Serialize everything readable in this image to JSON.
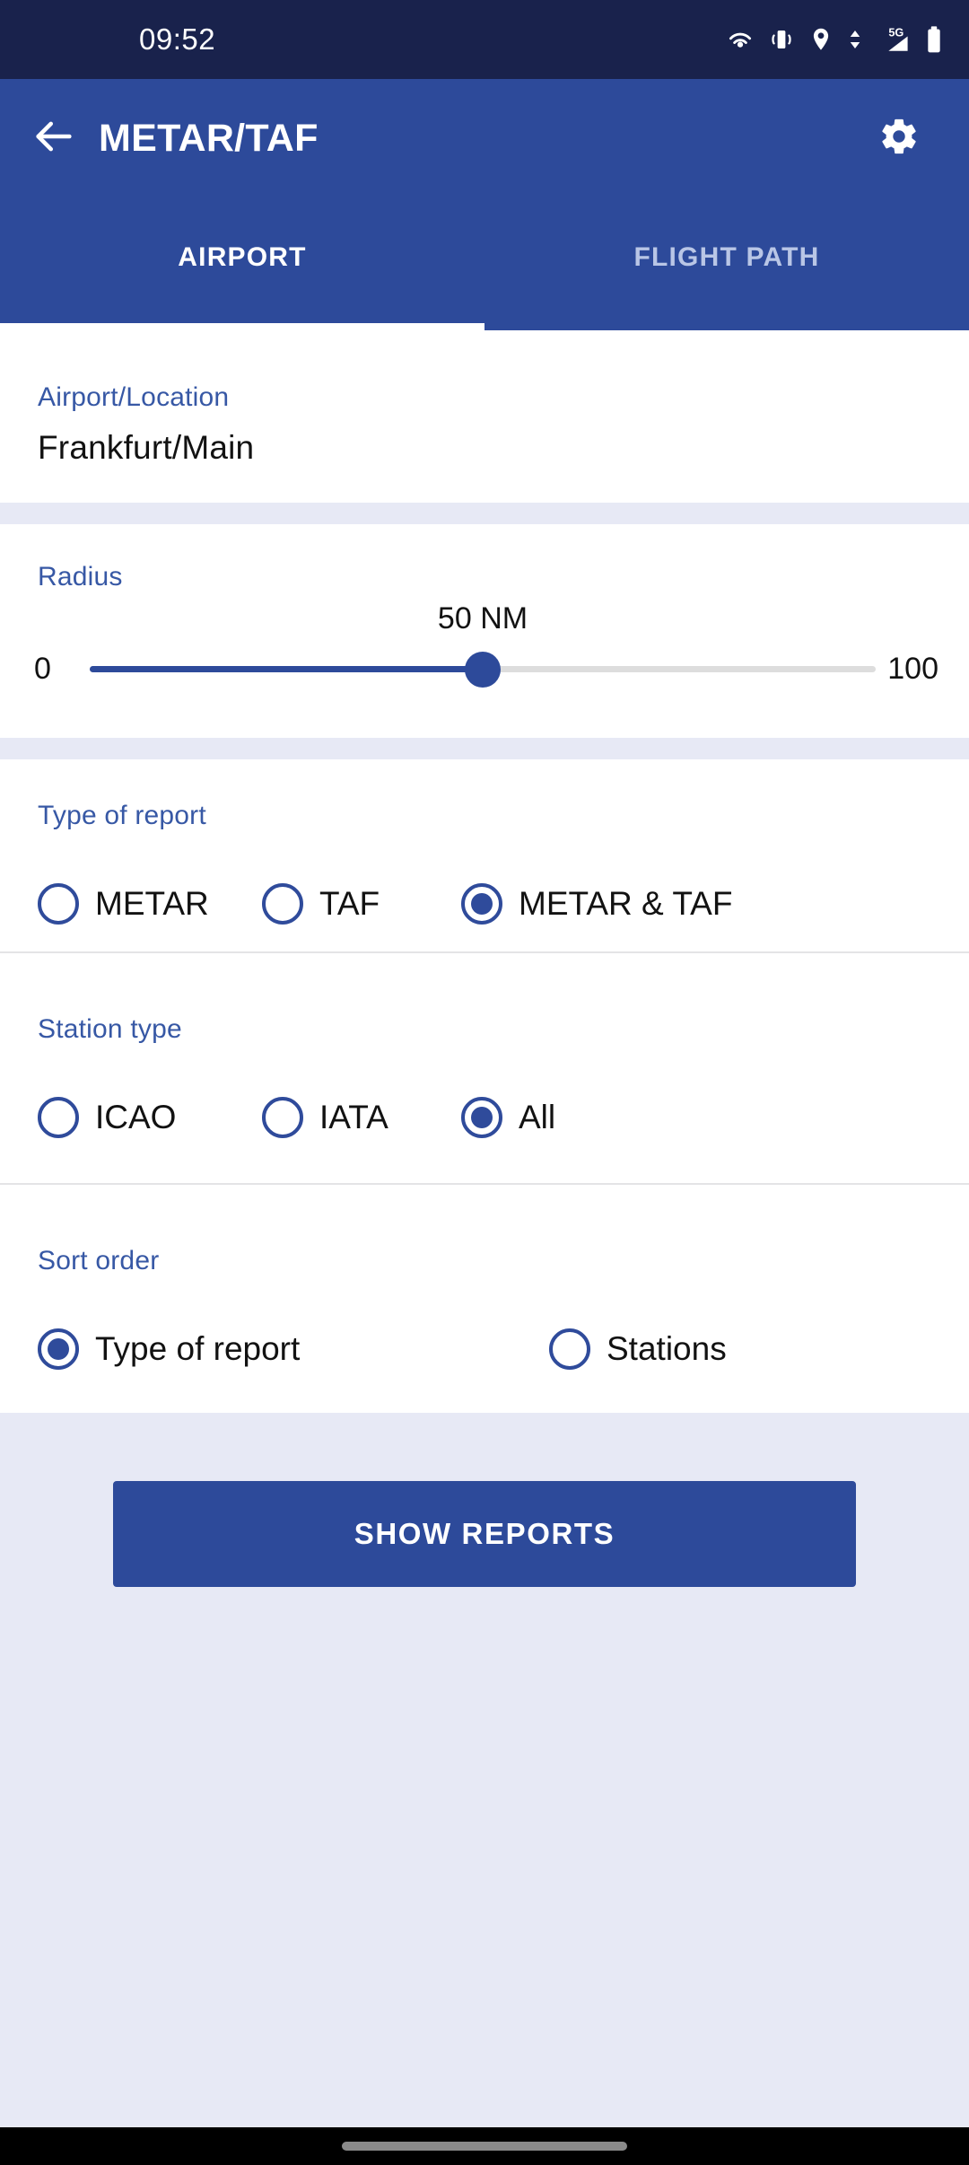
{
  "status_bar": {
    "time": "09:52",
    "network_label": "5G",
    "icons": [
      "cast-icon",
      "vibrate-icon",
      "location-icon",
      "data-transfer-icon",
      "signal-icon",
      "battery-icon"
    ],
    "background_color": "#19224C"
  },
  "app_bar": {
    "title": "METAR/TAF",
    "back_icon": "arrow-left-icon",
    "settings_icon": "gear-icon",
    "background_color": "#2D4A9A",
    "tabs": [
      {
        "label": "AIRPORT",
        "active": true
      },
      {
        "label": "FLIGHT PATH",
        "active": false
      }
    ]
  },
  "airport": {
    "label": "Airport/Location",
    "value": "Frankfurt/Main"
  },
  "radius": {
    "label": "Radius",
    "value_text": "50 NM",
    "value": 50,
    "min_label": "0",
    "max_label": "100",
    "min": 0,
    "max": 100,
    "accent_color": "#2D4A9A"
  },
  "type_of_report": {
    "label": "Type of report",
    "options": [
      {
        "label": "METAR",
        "selected": false
      },
      {
        "label": "TAF",
        "selected": false
      },
      {
        "label": "METAR & TAF",
        "selected": true
      }
    ]
  },
  "station_type": {
    "label": "Station type",
    "options": [
      {
        "label": "ICAO",
        "selected": false
      },
      {
        "label": "IATA",
        "selected": false
      },
      {
        "label": "All",
        "selected": true
      }
    ]
  },
  "sort_order": {
    "label": "Sort order",
    "options": [
      {
        "label": "Type of report",
        "selected": true
      },
      {
        "label": "Stations",
        "selected": false
      }
    ]
  },
  "actions": {
    "show_reports_label": "SHOW REPORTS"
  },
  "theme": {
    "label_blue": "#3758A5",
    "accent_blue": "#2D4A9A",
    "page_background": "#E7E9F5",
    "card_background": "#FFFFFF"
  }
}
